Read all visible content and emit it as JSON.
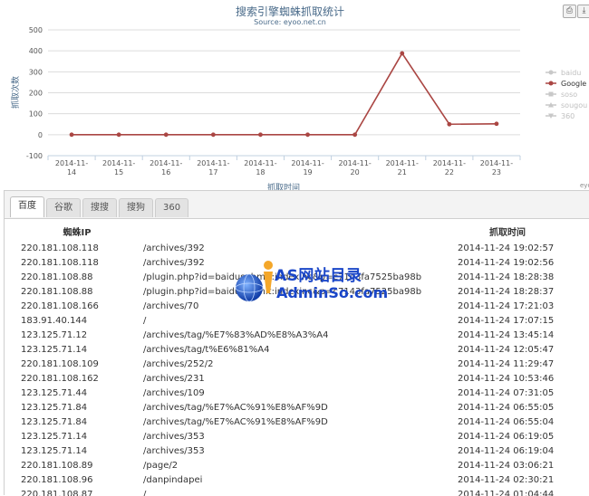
{
  "chart_data": {
    "type": "line",
    "title": "搜索引擎蜘蛛抓取统计",
    "subtitle": "Source: eyoo.net.cn",
    "xlabel": "抓取时间",
    "ylabel": "抓取次数",
    "ylim": [
      -100,
      500
    ],
    "yticks": [
      -100,
      0,
      100,
      200,
      300,
      400,
      500
    ],
    "categories": [
      "2014-11-14",
      "2014-11-15",
      "2014-11-16",
      "2014-11-17",
      "2014-11-18",
      "2014-11-19",
      "2014-11-20",
      "2014-11-21",
      "2014-11-22",
      "2014-11-23"
    ],
    "tick_labels": [
      [
        "2014-11-",
        "14"
      ],
      [
        "2014-11-",
        "15"
      ],
      [
        "2014-11-",
        "16"
      ],
      [
        "2014-11-",
        "17"
      ],
      [
        "2014-11-",
        "18"
      ],
      [
        "2014-11-",
        "19"
      ],
      [
        "2014-11-",
        "20"
      ],
      [
        "2014-11-",
        "21"
      ],
      [
        "2014-11-",
        "22"
      ],
      [
        "2014-11-",
        "23"
      ]
    ],
    "grid": true,
    "legend_position": "right",
    "series": [
      {
        "name": "baidu",
        "visible": false,
        "color": "#c8c8c8",
        "marker": "circle"
      },
      {
        "name": "Google",
        "visible": true,
        "color": "#aa4643",
        "marker": "circle",
        "values": [
          0,
          0,
          0,
          0,
          0,
          0,
          0,
          388,
          50,
          52
        ]
      },
      {
        "name": "soso",
        "visible": false,
        "color": "#c8c8c8",
        "marker": "square"
      },
      {
        "name": "sougou",
        "visible": false,
        "color": "#c8c8c8",
        "marker": "triangle"
      },
      {
        "name": "360",
        "visible": false,
        "color": "#c8c8c8",
        "marker": "triangle-down"
      }
    ],
    "credit": "eyo"
  },
  "tabs": [
    {
      "label": "百度",
      "active": true
    },
    {
      "label": "谷歌",
      "active": false
    },
    {
      "label": "搜搜",
      "active": false
    },
    {
      "label": "搜狗",
      "active": false
    },
    {
      "label": "360",
      "active": false
    }
  ],
  "table": {
    "columns": [
      "蜘蛛IP",
      "抓取时间"
    ],
    "rows": [
      {
        "ip": "220.181.108.118",
        "path": "/archives/392",
        "time": "2014-11-24 19:02:57"
      },
      {
        "ip": "220.181.108.118",
        "path": "/archives/392",
        "time": "2014-11-24 19:02:56"
      },
      {
        "ip": "220.181.108.88",
        "path": "/plugin.php?id=baidusubmit:indexinc&p=c7143fa7525ba98b",
        "time": "2014-11-24 18:28:38"
      },
      {
        "ip": "220.181.108.88",
        "path": "/plugin.php?id=baidusubmit:indexinc&p=c7143fa7525ba98b",
        "time": "2014-11-24 18:28:37"
      },
      {
        "ip": "220.181.108.166",
        "path": "/archives/70",
        "time": "2014-11-24 17:21:03"
      },
      {
        "ip": "183.91.40.144",
        "path": "/",
        "time": "2014-11-24 17:07:15"
      },
      {
        "ip": "123.125.71.12",
        "path": "/archives/tag/%E7%83%AD%E8%A3%A4",
        "time": "2014-11-24 13:45:14"
      },
      {
        "ip": "123.125.71.14",
        "path": "/archives/tag/t%E6%81%A4",
        "time": "2014-11-24 12:05:47"
      },
      {
        "ip": "220.181.108.109",
        "path": "/archives/252/2",
        "time": "2014-11-24 11:29:47"
      },
      {
        "ip": "220.181.108.162",
        "path": "/archives/231",
        "time": "2014-11-24 10:53:46"
      },
      {
        "ip": "123.125.71.44",
        "path": "/archives/109",
        "time": "2014-11-24 07:31:05"
      },
      {
        "ip": "123.125.71.84",
        "path": "/archives/tag/%E7%AC%91%E8%AF%9D",
        "time": "2014-11-24 06:55:05"
      },
      {
        "ip": "123.125.71.84",
        "path": "/archives/tag/%E7%AC%91%E8%AF%9D",
        "time": "2014-11-24 06:55:04"
      },
      {
        "ip": "123.125.71.14",
        "path": "/archives/353",
        "time": "2014-11-24 06:19:05"
      },
      {
        "ip": "123.125.71.14",
        "path": "/archives/353",
        "time": "2014-11-24 06:19:04"
      },
      {
        "ip": "220.181.108.89",
        "path": "/page/2",
        "time": "2014-11-24 03:06:21"
      },
      {
        "ip": "220.181.108.96",
        "path": "/danpindapei",
        "time": "2014-11-24 02:30:21"
      },
      {
        "ip": "220.181.108.87",
        "path": "/",
        "time": "2014-11-24 01:04:44"
      }
    ]
  },
  "watermark": {
    "line1": "AS网站目录",
    "line2": "AdminSo.com"
  },
  "icons": {
    "print": "print-icon",
    "download": "download-icon"
  },
  "colors": {
    "google_series": "#aa4643",
    "hidden_series": "#c8c8c8",
    "watermark": "#1a46c8"
  }
}
